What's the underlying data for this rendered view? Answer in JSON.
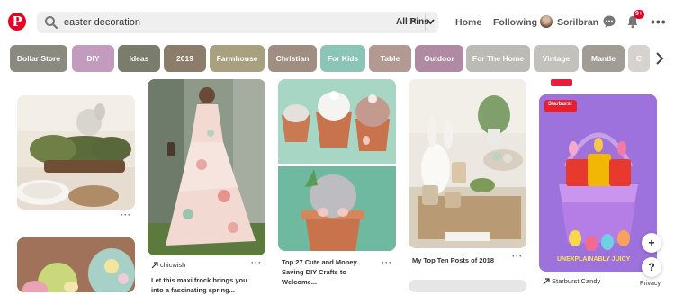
{
  "header": {
    "logo_icon": "pinterest-logo",
    "search_value": "easter decoration",
    "search_placeholder": "Search",
    "clear_icon": "close-icon",
    "scope_label": "All Pins",
    "nav_home": "Home",
    "nav_following": "Following",
    "profile_name": "Sorilbran",
    "notifications_badge": "9+"
  },
  "chips": [
    {
      "label": "Dollar Store",
      "color": "#8a8a80"
    },
    {
      "label": "DIY",
      "color": "#c29bbf"
    },
    {
      "label": "Ideas",
      "color": "#7a7d6b"
    },
    {
      "label": "2019",
      "color": "#8c7c6a"
    },
    {
      "label": "Farmhouse",
      "color": "#a8a07e"
    },
    {
      "label": "Christian",
      "color": "#a08f80"
    },
    {
      "label": "For Kids",
      "color": "#8cc4b8"
    },
    {
      "label": "Table",
      "color": "#b29a92"
    },
    {
      "label": "Outdoor",
      "color": "#b08aa3"
    },
    {
      "label": "For The Home",
      "color": "#bcbab4"
    },
    {
      "label": "Vintage",
      "color": "#c3c1bc"
    },
    {
      "label": "Mantle",
      "color": "#a29d94"
    },
    {
      "label": "C",
      "color": "#d6d3cf"
    }
  ],
  "pins": {
    "col2_source": "chicwish",
    "col2_caption_1": "Let this maxi frock brings you",
    "col2_caption_2": "into a fascinating spring...",
    "col3_caption_1": "Top 27 Cute and Money",
    "col3_caption_2": "Saving DIY Crafts to",
    "col3_caption_3": "Welcome...",
    "col4_caption": "My Top Ten Posts of 2018",
    "col5_ad_text": "UNEXPLAINABLY JUICY",
    "col5_ad_brand": "Starburst",
    "col5_source": "Starburst Candy"
  },
  "floating": {
    "add_label": "+",
    "help_label": "?",
    "privacy_label": "Privacy"
  }
}
